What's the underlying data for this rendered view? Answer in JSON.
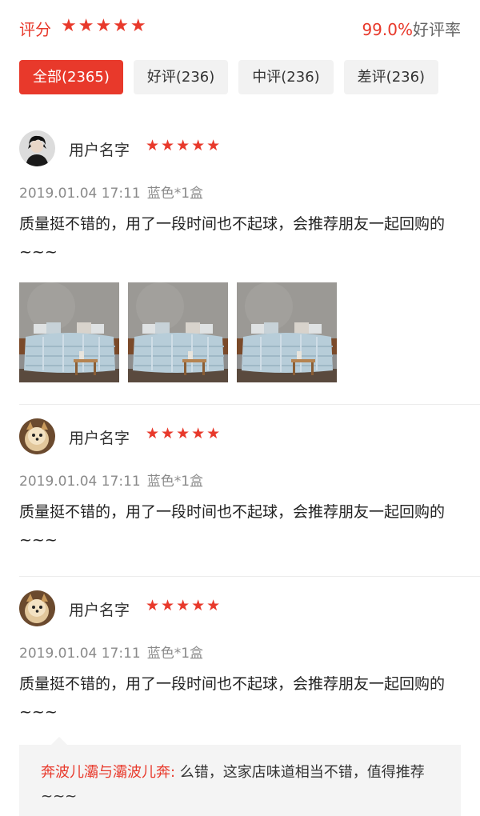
{
  "summary": {
    "score_label": "评分",
    "score_stars": "★★★★★",
    "good_rate_value": "99.0%",
    "good_rate_label": "好评率"
  },
  "filters": [
    {
      "label": "全部(2365)",
      "active": true
    },
    {
      "label": "好评(236)",
      "active": false
    },
    {
      "label": "中评(236)",
      "active": false
    },
    {
      "label": "差评(236)",
      "active": false
    }
  ],
  "reviews": [
    {
      "user_name": "用户名字",
      "stars": "★★★★★",
      "datetime": "2019.01.04 17:11",
      "sku": "蓝色*1盒",
      "content": "质量挺不错的，用了一段时间也不起球，会推荐朋友一起回购的~~~"
    },
    {
      "user_name": "用户名字",
      "stars": "★★★★★",
      "datetime": "2019.01.04 17:11",
      "sku": "蓝色*1盒",
      "content": "质量挺不错的，用了一段时间也不起球，会推荐朋友一起回购的~~~"
    },
    {
      "user_name": "用户名字",
      "stars": "★★★★★",
      "datetime": "2019.01.04 17:11",
      "sku": "蓝色*1盒",
      "content": "质量挺不错的，用了一段时间也不起球，会推荐朋友一起回购的~~~",
      "reply": {
        "author": "奔波儿灞与灞波儿奔:",
        "text": " 么错，这家店味道相当不错，值得推荐 ~~~"
      }
    }
  ],
  "colors": {
    "accent": "#e8392b",
    "filter_bg": "#f2f2f2",
    "meta_gray": "#8a8a8a"
  }
}
